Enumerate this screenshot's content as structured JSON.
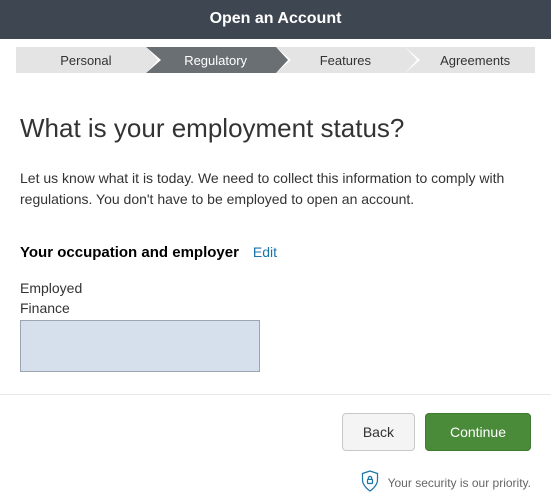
{
  "header": {
    "title": "Open an Account"
  },
  "steps": [
    {
      "label": "Personal",
      "active": false
    },
    {
      "label": "Regulatory",
      "active": true
    },
    {
      "label": "Features",
      "active": false
    },
    {
      "label": "Agreements",
      "active": false
    }
  ],
  "page": {
    "title": "What is your employment status?",
    "description": "Let us know what it is today. We need to collect this information to comply with regulations. You don't have to be employed to open an account."
  },
  "occupation_section": {
    "heading": "Your occupation and employer",
    "edit_label": "Edit",
    "status_value": "Employed",
    "industry_value": "Finance",
    "employer_value": ""
  },
  "buttons": {
    "back": "Back",
    "continue": "Continue"
  },
  "security": {
    "text": "Your security is our priority."
  },
  "colors": {
    "header_bg": "#3e4751",
    "step_active_bg": "#6a6f74",
    "continue_bg": "#4a8b3a",
    "edit_link": "#1976a8",
    "input_bg": "#d6e0ed"
  }
}
